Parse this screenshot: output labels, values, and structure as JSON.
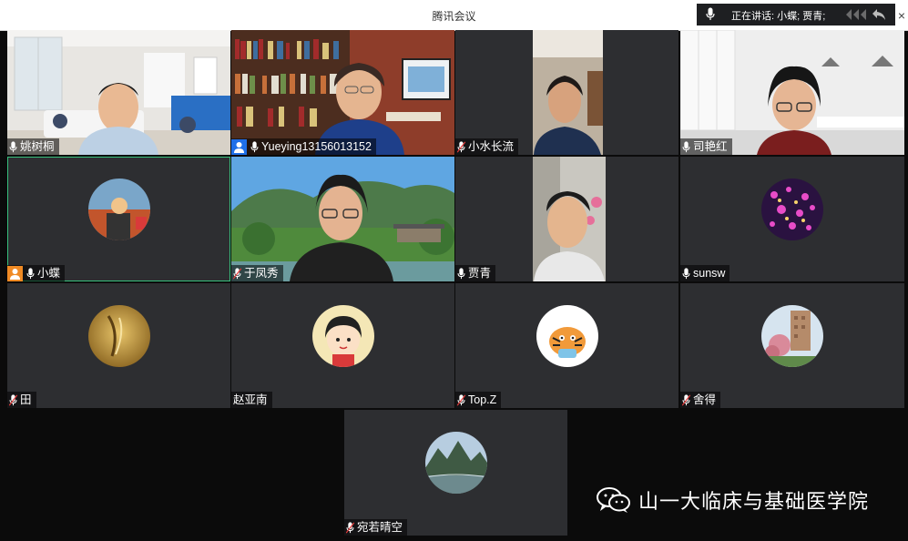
{
  "window": {
    "title": "腾讯会议",
    "close_icon": "×"
  },
  "speaking_banner": {
    "text": "正在讲话: 小蝶; 贾青;"
  },
  "participants": [
    {
      "name": "姚树桐"
    },
    {
      "name": "Yueying13156013152"
    },
    {
      "name": "小水长流"
    },
    {
      "name": "司艳红"
    },
    {
      "name": "小蝶"
    },
    {
      "name": "于凤秀"
    },
    {
      "name": "贾青"
    },
    {
      "name": "sunsw"
    },
    {
      "name": "田"
    },
    {
      "name": "赵亚南"
    },
    {
      "name": "Top.Z"
    },
    {
      "name": "舍得"
    },
    {
      "name": "宛若晴空"
    }
  ],
  "watermark": {
    "text": "山一大临床与基础医学院"
  },
  "colors": {
    "tile_bg": "#2d2e31",
    "active_border": "#38c17d",
    "host_badge": "#f08a24",
    "self_badge": "#1f6fe8"
  }
}
